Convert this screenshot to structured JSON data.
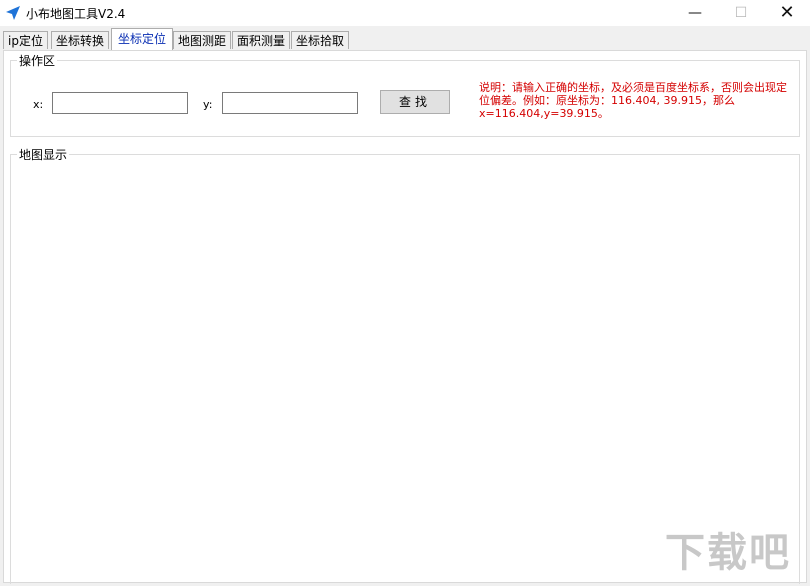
{
  "window": {
    "title": "小布地图工具V2.4",
    "min_glyph": "—",
    "max_glyph": "☐",
    "close_glyph": "✕",
    "icon": "send-arrow-icon"
  },
  "tabs": [
    {
      "label": "ip定位"
    },
    {
      "label": "坐标转换"
    },
    {
      "label": "坐标定位",
      "active": true
    },
    {
      "label": "地图测距"
    },
    {
      "label": "面积测量"
    },
    {
      "label": "坐标拾取"
    }
  ],
  "operations": {
    "legend": "操作区",
    "x_label": "x:",
    "x_value": "",
    "y_label": "y:",
    "y_value": "",
    "search_button": "查找",
    "note": "说明：请输入正确的坐标，及必须是百度坐标系，否则会出现定位偏差。例如：原坐标为：116.404, 39.915，那么x=116.404,y=39.915。"
  },
  "map": {
    "legend": "地图显示"
  },
  "colors": {
    "note_text": "#d40000",
    "active_tab_text": "#0a2fb3",
    "accent_icon": "#1e73d8"
  },
  "watermark": "下载吧"
}
